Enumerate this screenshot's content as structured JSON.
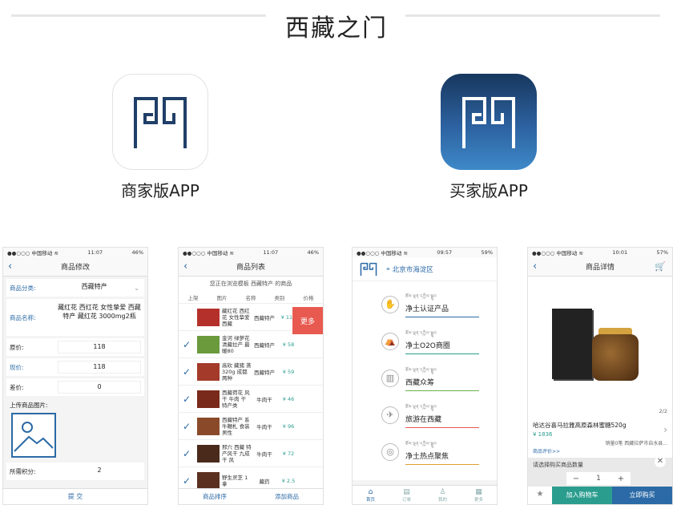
{
  "title": "西藏之门",
  "apps": {
    "merchant_label": "商家版APP",
    "buyer_label": "买家版APP"
  },
  "colors": {
    "accent": "#2b6aa6",
    "teal": "#2a9d8f",
    "red": "#e85a50"
  },
  "phone1": {
    "status_left": "●●○○○ 中国移动 ≋",
    "status_time": "11:07",
    "status_right": "46%",
    "nav_title": "商品修改",
    "rows": [
      {
        "label": "商品分类:",
        "value": "西藏特产"
      },
      {
        "label": "商品名称:",
        "value": "藏红花 西红花 女性挚爱 西藏特产 藏红花 3000mg2瓶"
      },
      {
        "label": "原价:",
        "value": "118"
      },
      {
        "label": "现价:",
        "value": "118"
      },
      {
        "label": "差价:",
        "value": "0"
      }
    ],
    "upload_label": "上传商品图片:",
    "points_label": "所需积分:",
    "points_value": "2",
    "submit": "提 交"
  },
  "phone2": {
    "status_left": "●●○○○ 中国移动 ≋",
    "status_time": "11:07",
    "status_right": "46%",
    "nav_title": "商品列表",
    "subtitle": "您正在浏览模板 西藏特产 的商品",
    "columns": [
      "上架",
      "图片",
      "名称",
      "类别",
      "价格"
    ],
    "items": [
      {
        "name": "藏红花 西红花 女性挚爱 西藏",
        "cat": "西藏特产",
        "price": "¥ 118"
      },
      {
        "name": "金诃 绿萝花 清藏拉产 最暖80",
        "cat": "西藏特产",
        "price": "¥ 58"
      },
      {
        "name": "高砍 藏猪 蒸320g 成都两种",
        "cat": "西藏特产",
        "price": "¥ 59"
      },
      {
        "name": "西藏荷花 风干 牛肉 干 特产类",
        "cat": "牛肉干",
        "price": "¥ 46"
      },
      {
        "name": "西藏特产 系牛鞭札 食装 男性",
        "cat": "牛肉干",
        "price": "¥ 96"
      },
      {
        "name": "邢穴 西藏 特产风干 九成干 风",
        "cat": "牛肉干",
        "price": "¥ 72"
      },
      {
        "name": "野生灵芝 1拿",
        "cat": "藏药",
        "price": "¥ 2.5"
      }
    ],
    "more": "更多",
    "sort": "商品排序",
    "add": "添加商品"
  },
  "phone3": {
    "status_left": "●●○○○ 中国移动 ≋",
    "status_time": "09:57",
    "status_right": "59%",
    "location": "北京市海淀区",
    "menu": [
      {
        "tib": "ཆོས་ལྡན་དཀྱིལ་སྒྲུབ",
        "label": "净土认证产品",
        "icon": "✋"
      },
      {
        "tib": "ཆོས་ལྡན་དཀྱིལ་སྒྲུབ",
        "label": "净土O2O商圈",
        "icon": "⛺"
      },
      {
        "tib": "ཆོས་ལྡན་དཀྱིལ་སྒྲུབ",
        "label": "西藏众筹",
        "icon": "▥"
      },
      {
        "tib": "ཆོས་ལྡན་དཀྱིལ་སྒྲུབ",
        "label": "旅游在西藏",
        "icon": "✈"
      },
      {
        "tib": "ཆོས་ལྡན་དཀྱིལ་སྒྲུབ",
        "label": "净土热点聚焦",
        "icon": "◎"
      }
    ],
    "tabs": [
      "首页",
      "订单",
      "我的",
      "更多"
    ]
  },
  "phone4": {
    "status_left": "●●○○○ 中国移动 ≋",
    "status_time": "10:01",
    "status_right": "57%",
    "nav_title": "商品详情",
    "pager": "2/2",
    "product_name": "哈达谷喜马拉雅高原森林蜜糖520g",
    "price": "¥ 1836",
    "meta": "销量0笔   西藏拉萨市自水县...",
    "review": "商品评价>>",
    "qty_label": "请选择购买商品数量",
    "qty_value": "1",
    "add_to_cart": "加入购物车",
    "buy_now": "立即购买",
    "fav": "关注"
  }
}
